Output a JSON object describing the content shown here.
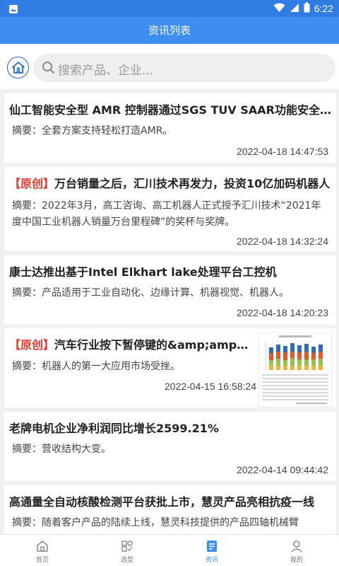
{
  "status_bar": {
    "time": "6:22",
    "icons": [
      "image-icon",
      "wifi-icon",
      "cell-signal-icon",
      "battery-icon"
    ]
  },
  "app_bar": {
    "title": "资讯列表"
  },
  "search": {
    "placeholder": "搜索产品、企业..."
  },
  "colors": {
    "primary": "#3d8ef0",
    "tag_red": "#e23a2f"
  },
  "articles": [
    {
      "tag": "",
      "title": "仙工智能安全型 AMR 控制器通过SGS TUV SAAR功能安全认证",
      "summary": "摘要：全套方案支持轻松打造AMR。",
      "time": "2022-04-18 14:47:53"
    },
    {
      "tag": "【原创】",
      "title": "万台销量之后，汇川技术再发力，投资10亿加码机器人",
      "summary": "摘要：2022年3月，高工咨询、高工机器人正式授予汇川技术“2021年度中国工业机器人销量万台里程碑”的奖杯与奖牌。",
      "time": "2022-04-18 14:32:24"
    },
    {
      "tag": "",
      "title": "康士达推出基于Intel Elkhart lake处理平台工控机",
      "summary": "摘要：产品适用于工业自动化、边缘计算、机器视觉、机器人。",
      "time": "2022-04-18 14:20:23"
    },
    {
      "tag": "【原创】",
      "title": "汽车行业按下暂停键的&amp;amp;quot;",
      "summary": "摘要：机器人的第一大应用市场受挫。",
      "time": "2022-04-15 16:58:24"
    },
    {
      "tag": "",
      "title": "老牌电机企业净利润同比增长2599.21%",
      "summary": "摘要：营收结构大变。",
      "time": "2022-04-14 09:44:42"
    },
    {
      "tag": "",
      "title": "高通量全自动核酸检测平台获批上市，慧灵产品亮相抗疫一线",
      "summary": "摘要：随着客户产品的陆续上线，慧灵科技提供的产品四轴机械臂",
      "time": ""
    }
  ],
  "bottom_nav": [
    {
      "label": "首页",
      "icon": "home-icon",
      "active": false
    },
    {
      "label": "选型",
      "icon": "selection-icon",
      "active": false
    },
    {
      "label": "资讯",
      "icon": "news-icon",
      "active": true
    },
    {
      "label": "我的",
      "icon": "profile-icon",
      "active": false
    }
  ]
}
